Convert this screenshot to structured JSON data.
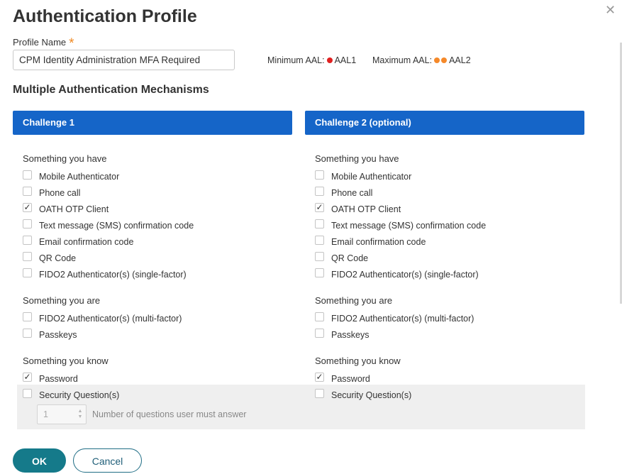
{
  "dialog": {
    "title": "Authentication Profile",
    "close_icon": "close-icon"
  },
  "profile": {
    "name_label": "Profile Name",
    "required_mark": "*",
    "name_value": "CPM Identity Administration MFA Required",
    "min_aal_label": "Minimum AAL:",
    "min_aal_value": "AAL1",
    "max_aal_label": "Maximum AAL:",
    "max_aal_value": "AAL2"
  },
  "colors": {
    "accent_blue": "#1565c8",
    "aal_red": "#e02020",
    "aal_orange": "#f5892a",
    "ok_teal": "#157a8a"
  },
  "mechanisms_title": "Multiple Authentication Mechanisms",
  "challenges": [
    {
      "header": "Challenge 1",
      "have_title": "Something you have",
      "have": [
        {
          "label": "Mobile Authenticator",
          "checked": false
        },
        {
          "label": "Phone call",
          "checked": false
        },
        {
          "label": "OATH OTP Client",
          "checked": true
        },
        {
          "label": "Text message (SMS) confirmation code",
          "checked": false
        },
        {
          "label": "Email confirmation code",
          "checked": false
        },
        {
          "label": "QR Code",
          "checked": false
        },
        {
          "label": "FIDO2 Authenticator(s) (single-factor)",
          "checked": false
        }
      ],
      "are_title": "Something you are",
      "are": [
        {
          "label": "FIDO2 Authenticator(s) (multi-factor)",
          "checked": false
        },
        {
          "label": "Passkeys",
          "checked": false
        }
      ],
      "know_title": "Something you know",
      "know": [
        {
          "label": "Password",
          "checked": true
        },
        {
          "label": "Security Question(s)",
          "checked": false
        }
      ]
    },
    {
      "header": "Challenge 2 (optional)",
      "have_title": "Something you have",
      "have": [
        {
          "label": "Mobile Authenticator",
          "checked": false
        },
        {
          "label": "Phone call",
          "checked": false
        },
        {
          "label": "OATH OTP Client",
          "checked": true
        },
        {
          "label": "Text message (SMS) confirmation code",
          "checked": false
        },
        {
          "label": "Email confirmation code",
          "checked": false
        },
        {
          "label": "QR Code",
          "checked": false
        },
        {
          "label": "FIDO2 Authenticator(s) (single-factor)",
          "checked": false
        }
      ],
      "are_title": "Something you are",
      "are": [
        {
          "label": "FIDO2 Authenticator(s) (multi-factor)",
          "checked": false
        },
        {
          "label": "Passkeys",
          "checked": false
        }
      ],
      "know_title": "Something you know",
      "know": [
        {
          "label": "Password",
          "checked": true
        },
        {
          "label": "Security Question(s)",
          "checked": false
        }
      ]
    }
  ],
  "questions": {
    "value": "1",
    "label": "Number of questions user must answer"
  },
  "buttons": {
    "ok": "OK",
    "cancel": "Cancel"
  }
}
